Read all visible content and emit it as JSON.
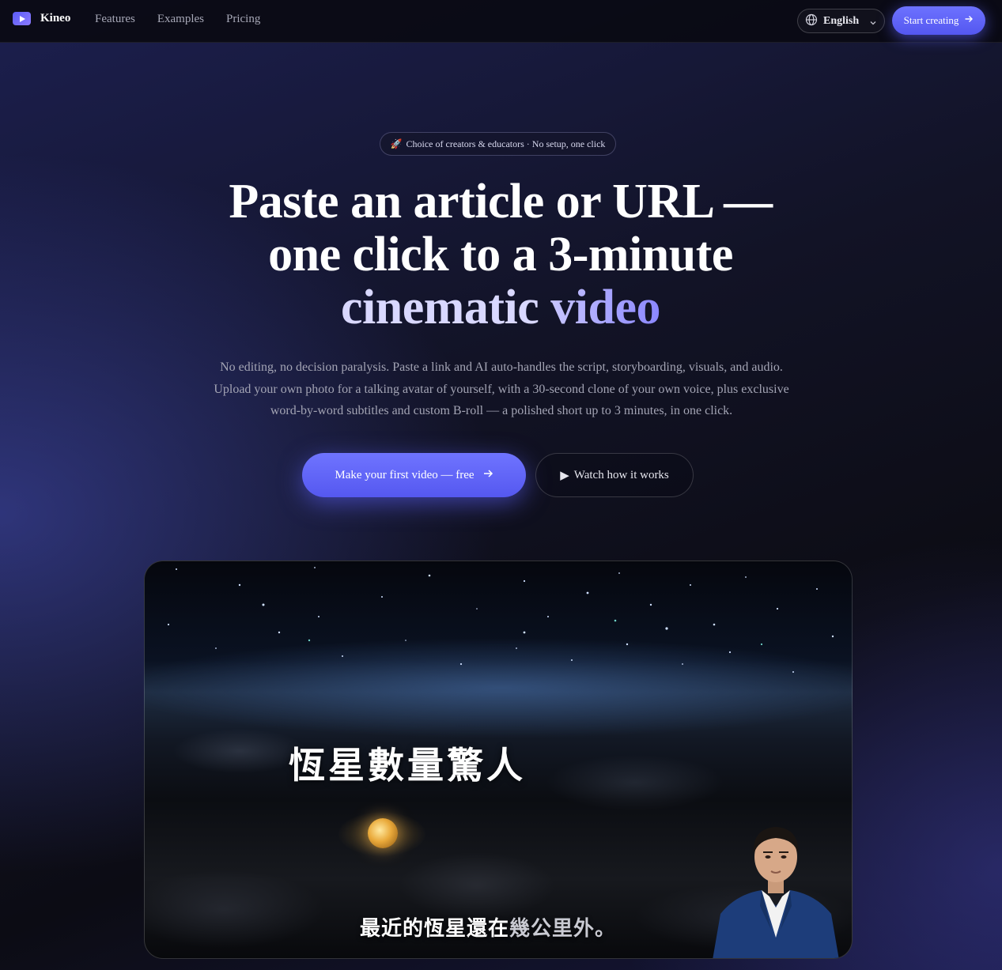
{
  "nav": {
    "brand": "Kineo",
    "links": [
      "Features",
      "Examples",
      "Pricing"
    ],
    "language": "English",
    "start_label": "Start creating"
  },
  "hero": {
    "badge_emoji": "🚀",
    "badge": "Choice of creators & educators · No setup, one click",
    "headline_line1": "Paste an article or URL —",
    "headline_line2": "one click to a 3-minute",
    "headline_line3_a": "cinematic",
    "headline_line3_b": "video",
    "subtext": "No editing, no decision paralysis. Paste a link and AI auto-handles the script, storyboarding, visuals, and audio. Upload your own photo for a talking avatar of yourself, with a 30-second clone of your own voice, plus exclusive word-by-word subtitles and custom B-roll — a polished short up to 3 minutes, in one click.",
    "cta_primary": "Make your first video — free",
    "cta_secondary": "Watch how it works",
    "cta_secondary_icon": "▶"
  },
  "video": {
    "title_caption": "恆星數量驚人",
    "subtitle_spoken": "最近的恆星還在",
    "subtitle_upcoming": "幾公里外",
    "subtitle_end": "。"
  },
  "colors": {
    "accent": "#5b5cf6",
    "accent_light": "#8a86ff",
    "nav_bg": "#0a0a12"
  }
}
